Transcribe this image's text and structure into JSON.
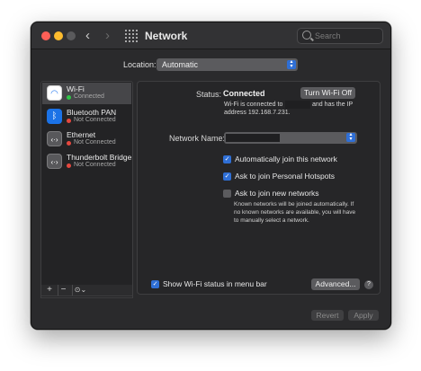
{
  "window": {
    "title": "Network",
    "search": {
      "placeholder": "Search",
      "value": ""
    }
  },
  "location": {
    "label": "Location:",
    "value": "Automatic"
  },
  "sidebar": {
    "items": [
      {
        "name": "Wi-Fi",
        "status": "Connected",
        "status_color": "#30c447",
        "icon": "wifi-icon"
      },
      {
        "name": "Bluetooth PAN",
        "status": "Not Connected",
        "status_color": "#e5483f",
        "icon": "bluetooth-icon"
      },
      {
        "name": "Ethernet",
        "status": "Not Connected",
        "status_color": "#e5483f",
        "icon": "ethernet-icon"
      },
      {
        "name": "Thunderbolt Bridge",
        "status": "Not Connected",
        "status_color": "#e5483f",
        "icon": "ethernet-icon"
      }
    ],
    "toolbar": {
      "add": "+",
      "remove": "−",
      "action": "⊙⌄"
    }
  },
  "detail": {
    "status_label": "Status:",
    "status_value": "Connected",
    "turn_off_button": "Turn Wi-Fi Off",
    "status_desc_part1": "Wi-Fi is connected to",
    "status_desc_part2": "and has the IP",
    "status_desc_line2": "address 192.168.7.231.",
    "network_name_label": "Network Name:",
    "checkboxes": [
      {
        "label": "Automatically join this network",
        "checked": true
      },
      {
        "label": "Ask to join Personal Hotspots",
        "checked": true
      },
      {
        "label": "Ask to join new networks",
        "checked": false
      }
    ],
    "note": "Known networks will be joined automatically. If no known networks are available, you will have to manually select a network.",
    "show_status_label": "Show Wi-Fi status in menu bar",
    "show_status_checked": true,
    "advanced_button": "Advanced...",
    "help": "?"
  },
  "footer": {
    "revert": "Revert",
    "apply": "Apply"
  },
  "colors": {
    "accent": "#2f6fd6",
    "connected": "#30c447",
    "not_connected": "#e5483f"
  }
}
